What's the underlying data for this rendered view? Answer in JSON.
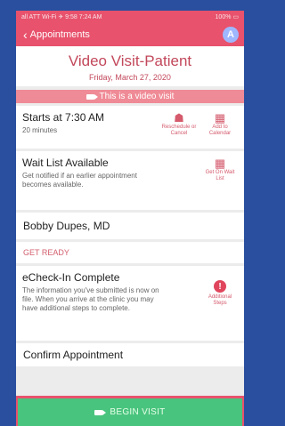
{
  "status": {
    "left": "all ATT Wi-Fi ✈ 9:58 7:24 AM",
    "right": "100% ▭"
  },
  "nav": {
    "back_label": "Appointments",
    "avatar_initial": "A"
  },
  "header": {
    "title": "Video Visit-Patient",
    "date": "Friday, March 27, 2020"
  },
  "banner": {
    "text": "This is a video visit"
  },
  "appointment": {
    "start": "Starts at 7:30 AM",
    "duration": "20 minutes",
    "reschedule": "Reschedule or Cancel",
    "calendar": "Add to Calendar"
  },
  "waitlist": {
    "title": "Wait List Available",
    "desc": "Get notified if an earlier appointment becomes available.",
    "action": "Get On Wait List"
  },
  "provider": {
    "name": "Bobby Dupes, MD"
  },
  "section": {
    "get_ready": "GET READY"
  },
  "echeckin": {
    "title": "eCheck-In Complete",
    "desc": "The information you've submitted is now on file. When you arrive at the clinic you may have additional steps to complete.",
    "action": "Additional Steps",
    "alert": "!"
  },
  "confirm": {
    "title": "Confirm Appointment"
  },
  "footer": {
    "begin_label": "BEGIN VISIT"
  }
}
